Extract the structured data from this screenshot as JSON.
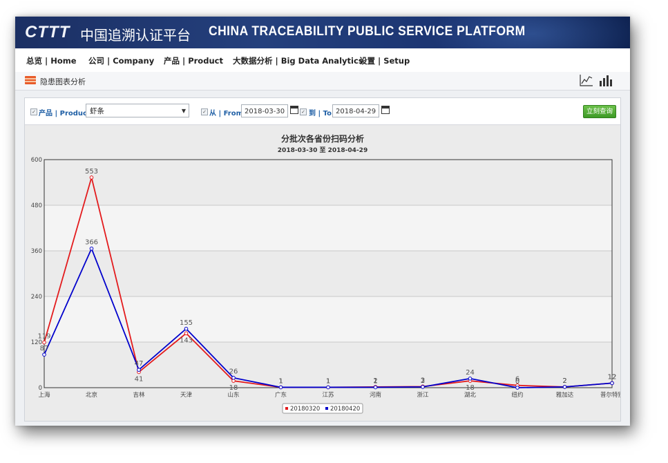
{
  "banner": {
    "logo": "CTTT",
    "title_cn": "中国追溯认证平台",
    "title_en": "CHINA TRACEABILITY PUBLIC SERVICE PLATFORM"
  },
  "menu": [
    {
      "label": "总览 | Home"
    },
    {
      "label": "公司 | Company"
    },
    {
      "label": "产品 | Product"
    },
    {
      "label": "大数据分析 | Big Data Analytics"
    },
    {
      "label": "设置 | Setup"
    }
  ],
  "page": {
    "title": "隐患图表分析",
    "icons": [
      "line-chart-icon",
      "bar-chart-icon"
    ]
  },
  "filters": {
    "product_label": "产品 | Product:",
    "product_value": "虾条",
    "from_label": "从 | From:",
    "from_value": "2018-03-30",
    "to_label": "到 | To:",
    "to_value": "2018-04-29",
    "query_button": "立刻查询"
  },
  "colors": {
    "series1": "#e31a1c",
    "series2": "#0000cc",
    "query_button": "#4caf2f",
    "banner": "#1f3a75"
  },
  "chart_data": {
    "type": "line",
    "title": "分批次各省份扫码分析",
    "subtitle": "2018-03-30 至 2018-04-29",
    "categories": [
      "上海",
      "北京",
      "吉林",
      "天津",
      "山东",
      "广东",
      "江苏",
      "河南",
      "浙江",
      "湖北",
      "纽约",
      "雅加达",
      "普尔特别"
    ],
    "series": [
      {
        "name": "20180320",
        "color": "#e31a1c",
        "values": [
          119,
          553,
          41,
          143,
          18,
          1,
          1,
          2,
          3,
          18,
          6,
          2,
          12
        ]
      },
      {
        "name": "20180420",
        "color": "#0000cc",
        "values": [
          87,
          366,
          47,
          155,
          26,
          1,
          1,
          1,
          2,
          24,
          0,
          2,
          12
        ]
      }
    ],
    "ylim": [
      0,
      600
    ],
    "yticks": [
      0,
      120,
      240,
      360,
      480,
      600
    ],
    "grid": true,
    "legend_position": "bottom"
  }
}
